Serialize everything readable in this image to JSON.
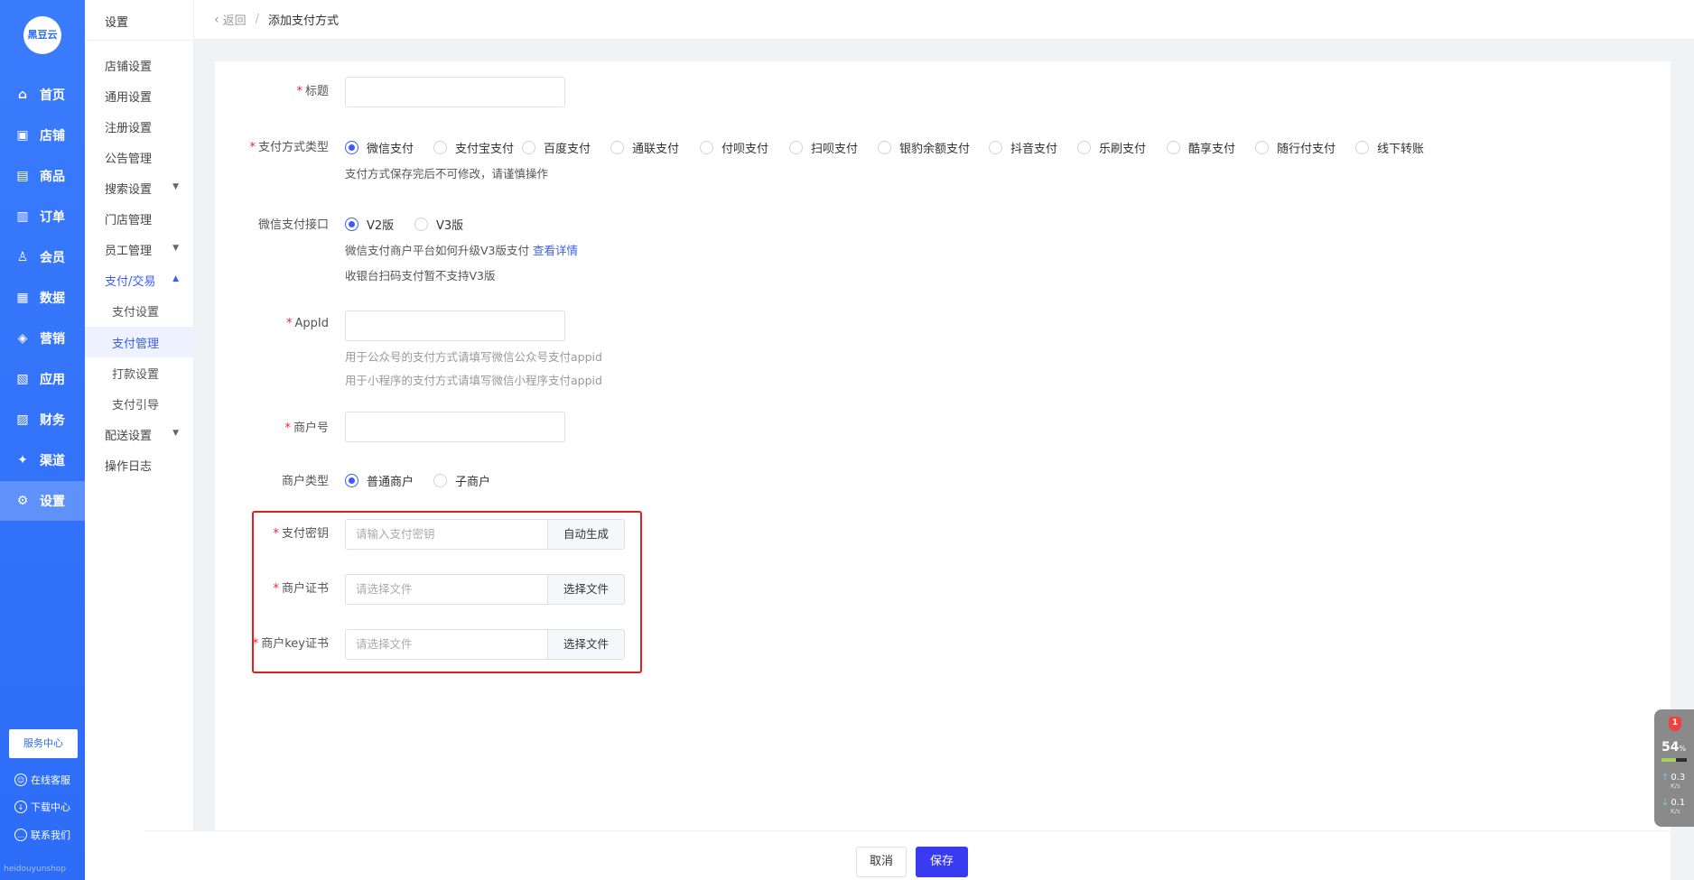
{
  "logo_text": "黑豆云",
  "nav": [
    {
      "label": "首页",
      "icon": "home-icon",
      "glyph": "⌂"
    },
    {
      "label": "店铺",
      "icon": "shop-icon",
      "glyph": "▣"
    },
    {
      "label": "商品",
      "icon": "goods-icon",
      "glyph": "▤"
    },
    {
      "label": "订单",
      "icon": "order-icon",
      "glyph": "▥"
    },
    {
      "label": "会员",
      "icon": "member-icon",
      "glyph": "♙"
    },
    {
      "label": "数据",
      "icon": "data-icon",
      "glyph": "▦"
    },
    {
      "label": "营销",
      "icon": "tag-icon",
      "glyph": "◈"
    },
    {
      "label": "应用",
      "icon": "app-icon",
      "glyph": "▧"
    },
    {
      "label": "财务",
      "icon": "finance-icon",
      "glyph": "▨"
    },
    {
      "label": "渠道",
      "icon": "channel-icon",
      "glyph": "✦"
    },
    {
      "label": "设置",
      "icon": "settings-icon",
      "glyph": "⚙"
    }
  ],
  "service_center": "服务中心",
  "bottom_links": [
    "在线客服",
    "下载中心",
    "联系我们"
  ],
  "footer_text": "heidouyunshop",
  "menu": {
    "title": "设置",
    "items": [
      {
        "label": "店铺设置"
      },
      {
        "label": "通用设置"
      },
      {
        "label": "注册设置"
      },
      {
        "label": "公告管理"
      },
      {
        "label": "搜索设置"
      },
      {
        "label": "门店管理"
      },
      {
        "label": "员工管理"
      },
      {
        "label": "支付/交易"
      },
      {
        "label": "支付设置"
      },
      {
        "label": "支付管理"
      },
      {
        "label": "打款设置"
      },
      {
        "label": "支付引导"
      },
      {
        "label": "配送设置"
      },
      {
        "label": "操作日志"
      }
    ]
  },
  "breadcrumb": {
    "back": "返回",
    "sep": "/",
    "current": "添加支付方式"
  },
  "form": {
    "title_label": "标题",
    "paytype_label": "支付方式类型",
    "paytypes": [
      "微信支付",
      "支付宝支付",
      "百度支付",
      "通联支付",
      "付呗支付",
      "扫呗支付",
      "银豹余额支付",
      "抖音支付",
      "乐刷支付",
      "酷享支付",
      "随行付支付",
      "线下转账"
    ],
    "paytype_tip": "支付方式保存完后不可修改，请谨慎操作",
    "wx_api_label": "微信支付接口",
    "wx_api_options": [
      "V2版",
      "V3版"
    ],
    "wx_tip1": "微信支付商户平台如何升级V3版支付",
    "wx_tip1_link": "查看详情",
    "wx_tip2": "收银台扫码支付暂不支持V3版",
    "appid_label": "AppId",
    "appid_tip1": "用于公众号的支付方式请填写微信公众号支付appid",
    "appid_tip2": "用于小程序的支付方式请填写微信小程序支付appid",
    "merchant_no_label": "商户号",
    "merchant_type_label": "商户类型",
    "merchant_types": [
      "普通商户",
      "子商户"
    ],
    "pay_key_label": "支付密钥",
    "pay_key_placeholder": "请输入支付密钥",
    "pay_key_button": "自动生成",
    "cert_label": "商户证书",
    "cert_placeholder": "请选择文件",
    "cert_button": "选择文件",
    "key_cert_label": "商户key证书",
    "key_cert_placeholder": "请选择文件",
    "key_cert_button": "选择文件",
    "required_mark": "*"
  },
  "actions": {
    "cancel": "取消",
    "save": "保存"
  },
  "net_widget": {
    "badge": "1",
    "percent": "54",
    "percent_unit": "%",
    "up": "0.3",
    "down": "0.1",
    "unit": "K/s"
  },
  "colors": {
    "primary": "#3a5ef5",
    "sidebar": "#2c6cf7",
    "highlight_box": "#e02020",
    "save_button": "#3a3bf0"
  }
}
